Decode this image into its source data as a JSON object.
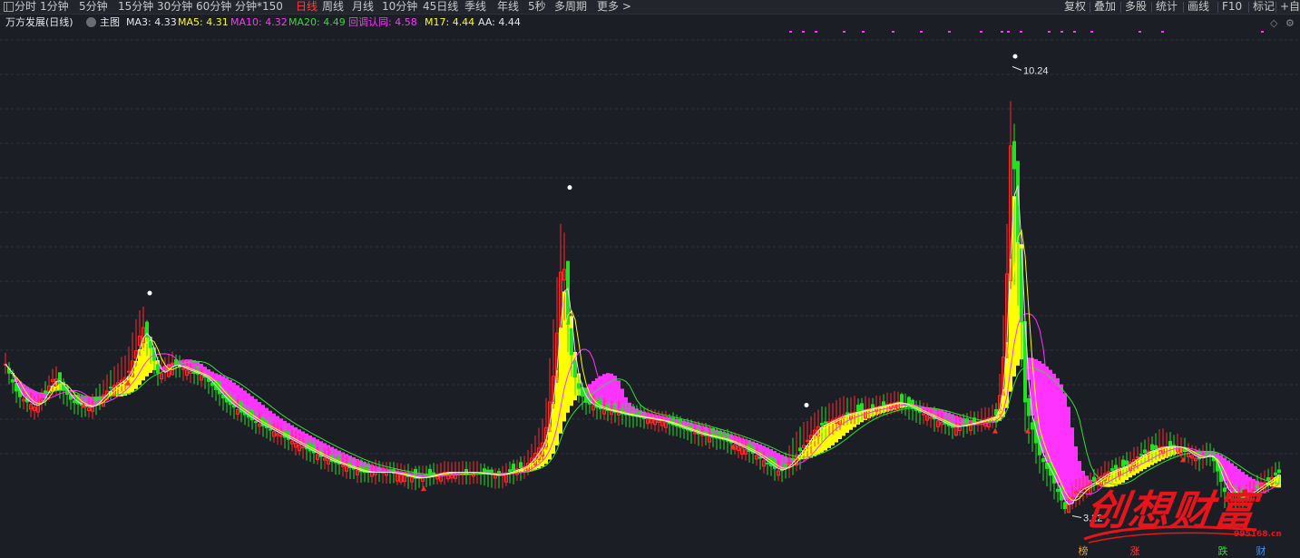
{
  "toolbar": {
    "left": [
      "分时",
      "1分钟",
      "5分钟",
      "15分钟",
      "30分钟",
      "60分钟",
      "分钟*150",
      "日线",
      "周线",
      "月线",
      "10分钟",
      "45日线",
      "季线",
      "年线",
      "5秒",
      "多周期",
      "更多 >"
    ],
    "active": "日线",
    "right": [
      "复权",
      "叠加",
      "多股",
      "统计",
      "画线",
      "F10",
      "标记",
      "+自"
    ]
  },
  "info": {
    "stock": "万方发展(日线)",
    "main_label": "主图",
    "indicators": [
      {
        "label": "MA3: 4.33",
        "color": "#e6e6e6"
      },
      {
        "label": "MA5: 4.31",
        "color": "#ffff00"
      },
      {
        "label": "MA10: 4.32",
        "color": "#ff33ff"
      },
      {
        "label": "MA20: 4.49",
        "color": "#33dd33"
      },
      {
        "label": "回调认同: 4.58",
        "color": "#ff33ff"
      },
      {
        "label": "M17: 4.44",
        "color": "#ffff00"
      },
      {
        "label": "AA: 4.44",
        "color": "#e6e6e6"
      }
    ]
  },
  "chart_data": {
    "type": "candlestick",
    "price_high_label": "10.24",
    "price_low_label": "3.22",
    "x": [
      0,
      20,
      40,
      60,
      80,
      100,
      120,
      140,
      150,
      157,
      165,
      175,
      190,
      205,
      225,
      250,
      280,
      320,
      360,
      400,
      430,
      460,
      490,
      520,
      550,
      580,
      600,
      612,
      620,
      627,
      635,
      645,
      660,
      690,
      730,
      770,
      800,
      830,
      860,
      880,
      900,
      930,
      960,
      990,
      1020,
      1050,
      1080,
      1100,
      1108,
      1115,
      1122,
      1130,
      1145,
      1160,
      1175,
      1185,
      1200,
      1220,
      1240,
      1260,
      1280,
      1300,
      1320,
      1335,
      1350,
      1370,
      1390,
      1410
    ],
    "close": [
      5.8,
      5.1,
      4.9,
      5.4,
      5.0,
      4.9,
      5.2,
      5.4,
      5.8,
      6.2,
      5.9,
      5.4,
      5.6,
      5.5,
      5.4,
      5.0,
      4.7,
      4.4,
      4.1,
      3.9,
      3.9,
      3.8,
      3.9,
      3.9,
      3.85,
      4.0,
      4.4,
      5.6,
      7.5,
      6.0,
      5.3,
      5.0,
      4.9,
      4.8,
      4.7,
      4.5,
      4.4,
      4.2,
      3.9,
      4.2,
      4.6,
      4.8,
      4.9,
      5.0,
      4.8,
      4.6,
      4.7,
      4.8,
      6.0,
      9.5,
      7.5,
      5.0,
      4.2,
      3.8,
      3.3,
      3.6,
      3.7,
      3.9,
      4.0,
      4.2,
      4.3,
      4.3,
      4.1,
      4.2,
      3.6,
      3.5,
      3.7,
      3.9
    ],
    "high": [
      6.0,
      5.3,
      5.1,
      5.6,
      5.2,
      5.1,
      5.5,
      5.8,
      6.3,
      6.6,
      6.1,
      5.7,
      5.8,
      5.7,
      5.5,
      5.2,
      4.9,
      4.6,
      4.3,
      4.1,
      4.1,
      4.0,
      4.1,
      4.1,
      4.0,
      4.2,
      4.8,
      6.6,
      8.2,
      6.4,
      5.6,
      5.2,
      5.1,
      5.0,
      4.9,
      4.7,
      4.6,
      4.4,
      4.1,
      4.6,
      4.9,
      5.1,
      5.1,
      5.2,
      5.0,
      4.8,
      4.9,
      5.0,
      6.8,
      10.24,
      8.2,
      5.4,
      4.5,
      4.0,
      3.5,
      3.8,
      3.9,
      4.1,
      4.2,
      4.4,
      4.6,
      4.5,
      4.3,
      4.4,
      3.8,
      3.7,
      3.9,
      4.1
    ],
    "low": [
      5.6,
      4.9,
      4.7,
      5.1,
      4.8,
      4.7,
      5.0,
      5.2,
      5.5,
      5.8,
      5.6,
      5.2,
      5.4,
      5.3,
      5.2,
      4.8,
      4.5,
      4.2,
      3.9,
      3.7,
      3.7,
      3.6,
      3.7,
      3.7,
      3.6,
      3.8,
      4.1,
      5.0,
      6.5,
      5.6,
      5.0,
      4.8,
      4.7,
      4.6,
      4.5,
      4.3,
      4.2,
      4.0,
      3.7,
      3.9,
      4.3,
      4.6,
      4.7,
      4.8,
      4.6,
      4.4,
      4.5,
      4.6,
      5.2,
      7.0,
      6.5,
      4.5,
      3.9,
      3.5,
      3.22,
      3.3,
      3.5,
      3.7,
      3.8,
      4.0,
      4.1,
      4.1,
      3.9,
      4.0,
      3.3,
      3.3,
      3.5,
      3.7
    ],
    "ylim": [
      3.0,
      10.6
    ],
    "series": [
      {
        "name": "MA3",
        "color": "#e6e6e6"
      },
      {
        "name": "MA5",
        "color": "#ffff00"
      },
      {
        "name": "MA10",
        "color": "#ff33ff"
      },
      {
        "name": "MA20",
        "color": "#33dd33"
      }
    ],
    "colors": {
      "up": "#ff2a2a",
      "down": "#22e022",
      "band_up": "#ffff00",
      "band_down": "#ff33ff",
      "grid": "#2f323b"
    }
  },
  "bottom_tags": [
    {
      "label": "榜",
      "color": "#f0a030"
    },
    {
      "label": "涨",
      "color": "#ff3d3d"
    },
    {
      "label": "跌",
      "color": "#33dd33"
    },
    {
      "label": "财",
      "color": "#3399ff"
    }
  ],
  "watermark": {
    "text": "创想财富",
    "url": "995168.cn"
  }
}
